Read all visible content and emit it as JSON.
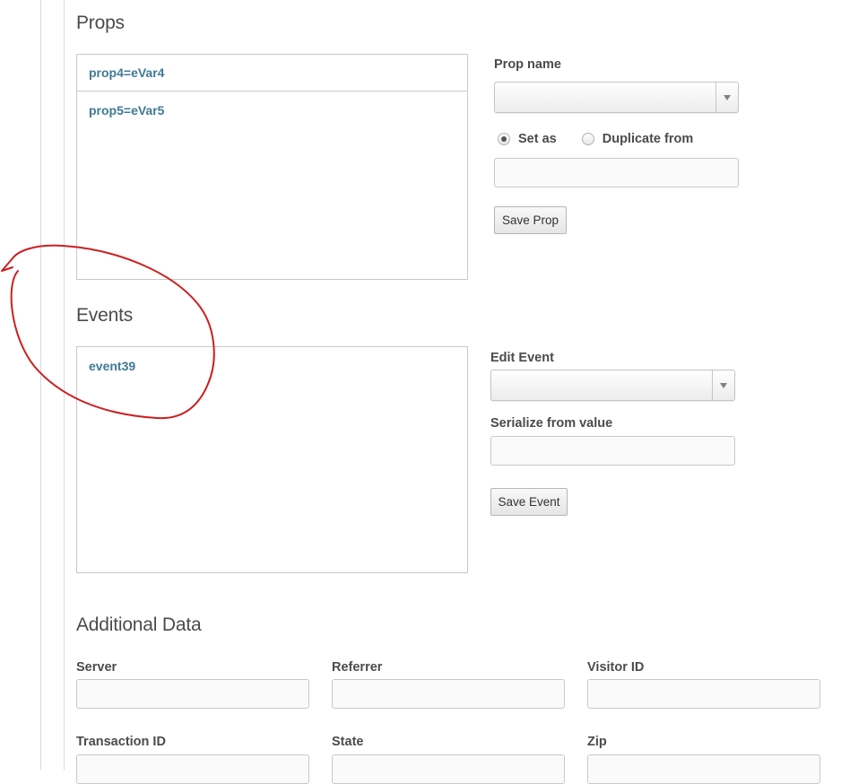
{
  "props": {
    "title": "Props",
    "list": [
      "prop4=eVar4",
      "prop5=eVar5"
    ],
    "prop_name_label": "Prop name",
    "prop_name_selected": "",
    "radio_set_as": "Set as",
    "radio_duplicate_from": "Duplicate from",
    "radio_selected": "Set as",
    "value_input": "",
    "save_label": "Save Prop"
  },
  "events": {
    "title": "Events",
    "list": [
      "event39"
    ],
    "edit_event_label": "Edit Event",
    "edit_event_selected": "",
    "serialize_label": "Serialize from value",
    "serialize_value": "",
    "save_label": "Save Event"
  },
  "additional": {
    "title": "Additional Data",
    "fields": [
      {
        "label": "Server",
        "value": ""
      },
      {
        "label": "Referrer",
        "value": ""
      },
      {
        "label": "Visitor ID",
        "value": ""
      },
      {
        "label": "Transaction ID",
        "value": ""
      },
      {
        "label": "State",
        "value": ""
      },
      {
        "label": "Zip",
        "value": ""
      }
    ]
  },
  "colors": {
    "link_blue": "#3f7a95",
    "annotation_red": "#cc1f1f",
    "border_gray": "#c8c8c8"
  },
  "icons": {
    "select_arrow": "chevron-down-icon"
  }
}
